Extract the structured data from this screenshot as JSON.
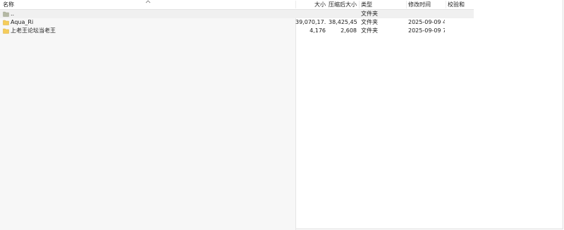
{
  "columns": {
    "name": "名称",
    "size": "大小",
    "packed": "压缩后大小",
    "type": "类型",
    "modified": "修改时间",
    "checksum": "校验和"
  },
  "rows": [
    {
      "icon": "parent-folder-icon",
      "name": "..",
      "size": "",
      "packed": "",
      "type": "文件夹",
      "modified": "",
      "checksum": ""
    },
    {
      "icon": "folder-icon",
      "name": "Aqua_Ri",
      "size": "39,070,17...",
      "packed": "38,425,45...",
      "type": "文件夹",
      "modified": "2025-09-09 4...",
      "checksum": ""
    },
    {
      "icon": "folder-icon",
      "name": "上老王论坛当老王",
      "size": "4,176",
      "packed": "2,608",
      "type": "文件夹",
      "modified": "2025-09-09 7...",
      "checksum": ""
    }
  ],
  "colors": {
    "folder": "#f5cd5b",
    "parent_folder": "#b4b8a4",
    "selection": "#f0f0f0"
  }
}
